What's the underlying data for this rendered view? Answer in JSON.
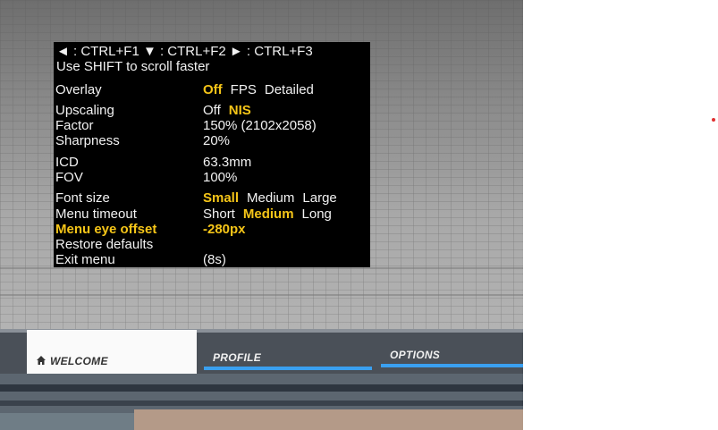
{
  "menu": {
    "shortcuts_line": "◄ : CTRL+F1   ▼ : CTRL+F2   ► : CTRL+F3",
    "shift_hint": "Use SHIFT to scroll faster",
    "rows": {
      "overlay": {
        "label": "Overlay",
        "options": [
          "Off",
          "FPS",
          "Detailed"
        ],
        "selected": "Off"
      },
      "upscaling": {
        "label": "Upscaling",
        "options": [
          "Off",
          "NIS"
        ],
        "selected": "NIS"
      },
      "factor": {
        "label": "Factor",
        "value": "150% (2102x2058)"
      },
      "sharpness": {
        "label": "Sharpness",
        "value": "20%"
      },
      "icd": {
        "label": "ICD",
        "value": "63.3mm"
      },
      "fov": {
        "label": "FOV",
        "value": "100%"
      },
      "font_size": {
        "label": "Font size",
        "options": [
          "Small",
          "Medium",
          "Large"
        ],
        "selected": "Small"
      },
      "menu_timeout": {
        "label": "Menu timeout",
        "options": [
          "Short",
          "Medium",
          "Long"
        ],
        "selected": "Medium"
      },
      "menu_eye_offset": {
        "label": "Menu eye offset",
        "value": "-280px",
        "highlighted": true
      },
      "restore_defaults": {
        "label": "Restore defaults"
      },
      "exit_menu": {
        "label": "Exit menu",
        "value": "(8s)"
      }
    },
    "highlight_color": "#f5c518"
  },
  "tabs": {
    "welcome": {
      "label": "WELCOME",
      "icon": "home-icon",
      "active": true
    },
    "profile": {
      "label": "PROFILE"
    },
    "options": {
      "label": "OPTIONS"
    },
    "accent_color": "#3aa0f0"
  }
}
